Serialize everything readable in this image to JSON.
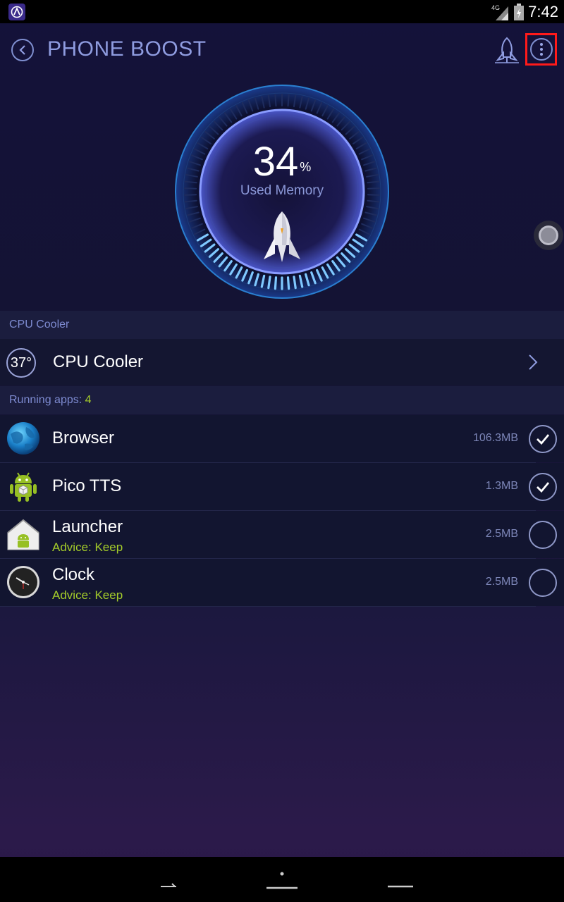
{
  "status_bar": {
    "network": "4G",
    "time": "7:42"
  },
  "header": {
    "title": "PHONE BOOST"
  },
  "gauge": {
    "percent": "34",
    "percent_sign": "%",
    "label": "Used Memory",
    "used_fraction": 0.34
  },
  "cpu_section": {
    "header": "CPU Cooler",
    "temperature": "37°",
    "label": "CPU Cooler"
  },
  "running": {
    "label": "Running apps:",
    "count": "4"
  },
  "apps": [
    {
      "name": "Browser",
      "size": "106.3MB",
      "advice": "",
      "checked": true,
      "icon": "browser-globe-icon"
    },
    {
      "name": "Pico TTS",
      "size": "1.3MB",
      "advice": "",
      "checked": true,
      "icon": "android-robot-icon"
    },
    {
      "name": "Launcher",
      "size": "2.5MB",
      "advice": "Advice: Keep",
      "checked": false,
      "icon": "launcher-house-icon"
    },
    {
      "name": "Clock",
      "size": "2.5MB",
      "advice": "Advice: Keep",
      "checked": false,
      "icon": "clock-icon"
    }
  ],
  "colors": {
    "accent_green": "#a4cc2a",
    "header_blue": "#8f9ce0",
    "highlight_red": "#ff1a1a"
  }
}
